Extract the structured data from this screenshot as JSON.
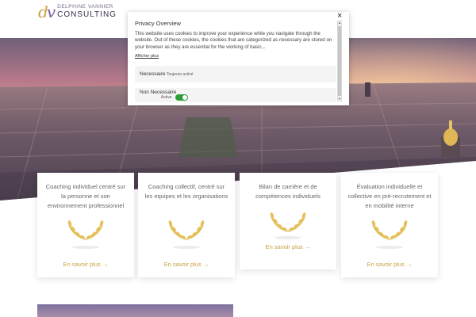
{
  "brand": {
    "mark_d": "d",
    "mark_v": "v",
    "top": "DELPHINE VANNIER",
    "bottom": "CONSULTING"
  },
  "privacy": {
    "close": "×",
    "title": "Privacy Overview",
    "body": "This website uses cookies to improve your experience while you navigate through the website. Out of these cookies, the cookies that are categorized as necessary are stored on your browser as they are essential for the working of basic...",
    "more_link": "Afficher plus",
    "rows": [
      {
        "label": "Necessaire",
        "status": "Toujours activé"
      },
      {
        "label": "Non Necessaire",
        "status": "Active"
      }
    ]
  },
  "cards": [
    {
      "text": "Coaching individuel centré sur la personne et son environnement professionnel",
      "link": "En savoir plus →"
    },
    {
      "text": "Coaching collectif, centré sur les equipes et les organisations",
      "link": "En savoir plus →"
    },
    {
      "text": "Bilan de carrière et de compétences individuels",
      "link": "En savoir plus →"
    },
    {
      "text": "Évaluation individuelle et collective en pré-recrutement et en mobilité interne",
      "link": "En savoir plus →"
    }
  ],
  "colors": {
    "accent": "#c9a043",
    "toggle_on": "#2e9e3a",
    "brand_purple": "#3b2e4a"
  }
}
